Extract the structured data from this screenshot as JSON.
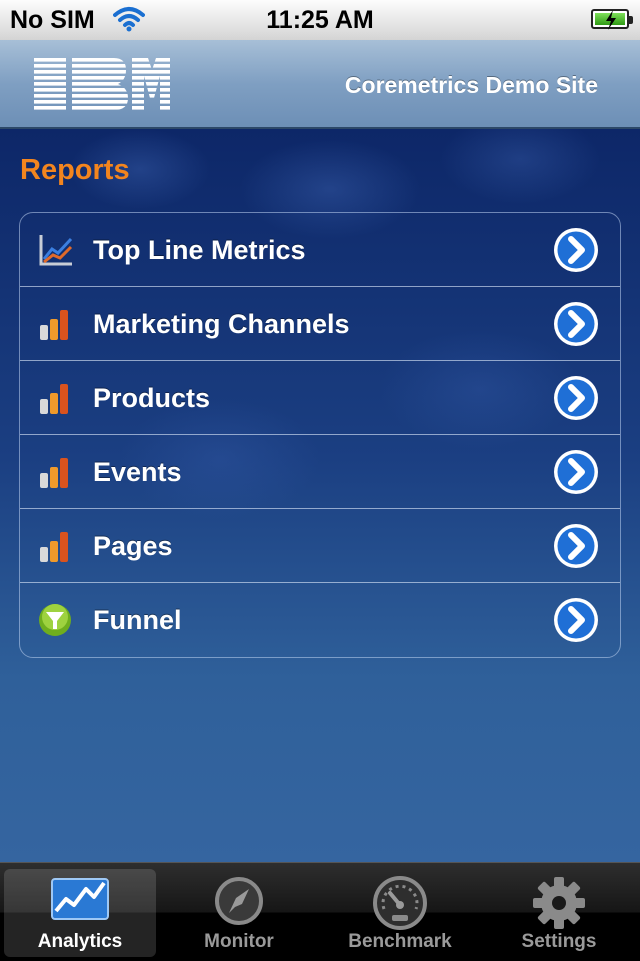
{
  "status_bar": {
    "carrier": "No SIM",
    "time": "11:25 AM"
  },
  "header": {
    "logo_text": "IBM",
    "site_name": "Coremetrics Demo Site"
  },
  "reports": {
    "title": "Reports",
    "items": [
      {
        "label": "Top Line Metrics",
        "icon": "line-chart-icon"
      },
      {
        "label": "Marketing Channels",
        "icon": "bar-chart-icon"
      },
      {
        "label": "Products",
        "icon": "bar-chart-icon"
      },
      {
        "label": "Events",
        "icon": "bar-chart-icon"
      },
      {
        "label": "Pages",
        "icon": "bar-chart-icon"
      },
      {
        "label": "Funnel",
        "icon": "funnel-icon"
      }
    ]
  },
  "tab_bar": {
    "tabs": [
      {
        "label": "Analytics",
        "icon": "analytics-icon",
        "active": true
      },
      {
        "label": "Monitor",
        "icon": "compass-icon",
        "active": false
      },
      {
        "label": "Benchmark",
        "icon": "speedometer-icon",
        "active": false
      },
      {
        "label": "Settings",
        "icon": "gear-icon",
        "active": false
      }
    ]
  },
  "colors": {
    "accent_orange": "#f3851e",
    "disclosure_blue": "#1f6fd6",
    "header_blue": "#7f9fc2"
  }
}
